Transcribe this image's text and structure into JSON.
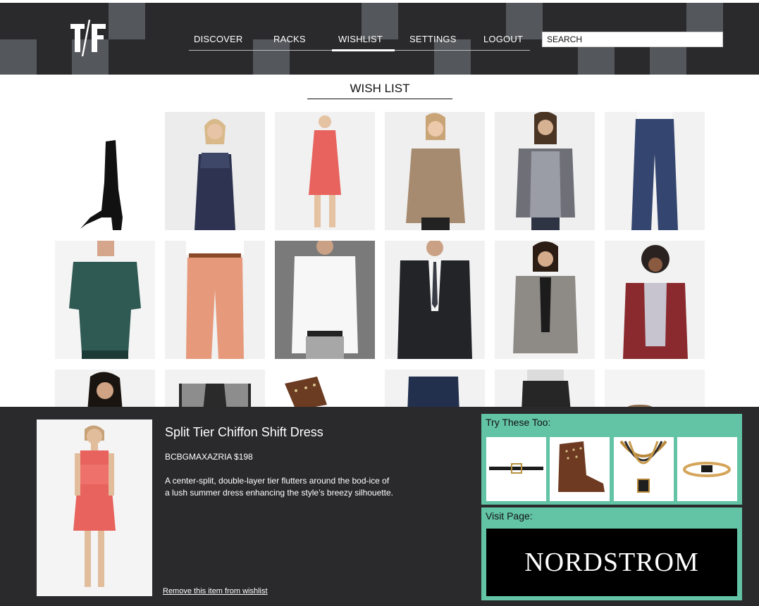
{
  "header": {
    "logo_text": "T/F",
    "nav": [
      "DISCOVER",
      "RACKS",
      "WISHLIST",
      "SETTINGS",
      "LOGOUT"
    ],
    "active_nav": "WISHLIST",
    "search_placeholder": "SEARCH"
  },
  "page_title": "WISH LIST",
  "grid": {
    "rows": [
      [
        "thigh-high black suede boot",
        "sequined navy cocktail dress",
        "coral tiered shift dress",
        "taupe leather moto jacket",
        "tweed zip jacket with knit sleeves",
        "navy wide-leg trousers"
      ],
      [
        "teal leather peplum top",
        "coral linen trousers",
        "white slim dress shirt",
        "black two-button suit",
        "boucle tweed jacket",
        "burgundy cardigan with plaid shirt"
      ],
      [
        "black dress",
        "grey vest over black tee",
        "studded brown boot",
        "dark denim jeans",
        "black leather shorts",
        "bracelet"
      ]
    ]
  },
  "detail": {
    "name": "Split Tier Chiffon Shift Dress",
    "brand_price": "BCBGMAXAZRIA $198",
    "description": "A center-split, double-layer tier flutters around the bod-ice of a lush summer dress enhancing the style’s breezy silhouette.",
    "remove_link": "Remove this item from wishlist"
  },
  "try_these": {
    "title": "Try These Too:",
    "items": [
      "black skinny belt",
      "studded brown ankle boot",
      "layered gold bib necklace",
      "gold bangle bracelet"
    ]
  },
  "visit": {
    "title": "Visit Page:",
    "store": "NORDSTROM"
  },
  "colors": {
    "header_bg": "#2a2a2c",
    "header_block": "#54575b",
    "accent_green": "#63c3a5",
    "coral": "#e8625e"
  }
}
